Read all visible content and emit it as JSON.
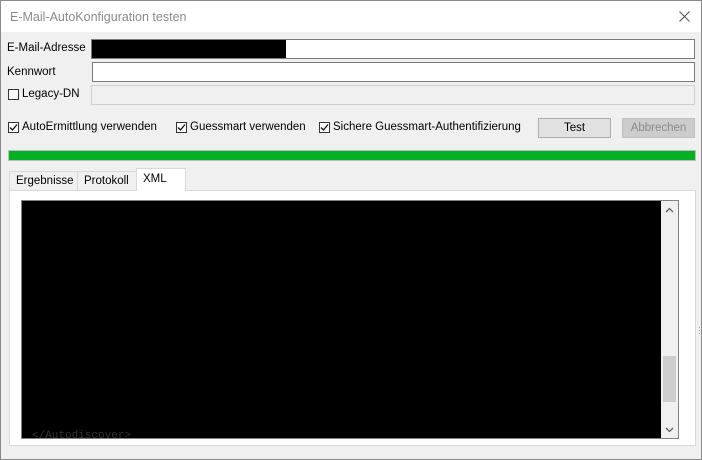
{
  "window": {
    "title": "E-Mail-AutoKonfiguration testen"
  },
  "form": {
    "email_label": "E-Mail-Adresse",
    "email_value": "",
    "password_label": "Kennwort",
    "password_value": "",
    "legacy_dn_label": "Legacy-DN",
    "legacy_dn_checked": false,
    "legacy_dn_value": ""
  },
  "options": {
    "autodiscover_label": "AutoErmittlung verwenden",
    "autodiscover_checked": true,
    "guessmart_label": "Guessmart verwenden",
    "guessmart_checked": true,
    "secure_guessmart_label": "Sichere Guessmart-Authentifizierung",
    "secure_guessmart_checked": true
  },
  "buttons": {
    "test_label": "Test",
    "cancel_label": "Abbrechen",
    "cancel_enabled": false
  },
  "progress": {
    "percent": 100,
    "color": "#06b025"
  },
  "tabs": [
    {
      "label": "Ergebnisse",
      "active": false
    },
    {
      "label": "Protokoll",
      "active": false
    },
    {
      "label": "XML",
      "active": true
    }
  ],
  "xml_panel": {
    "content": "",
    "visible_fragment": "</Autodiscover>",
    "scroll_position": 0.88
  },
  "icons": {
    "close": "close-icon",
    "check": "checkmark-icon",
    "scroll_up": "chevron-up-icon",
    "scroll_down": "chevron-down-icon"
  }
}
